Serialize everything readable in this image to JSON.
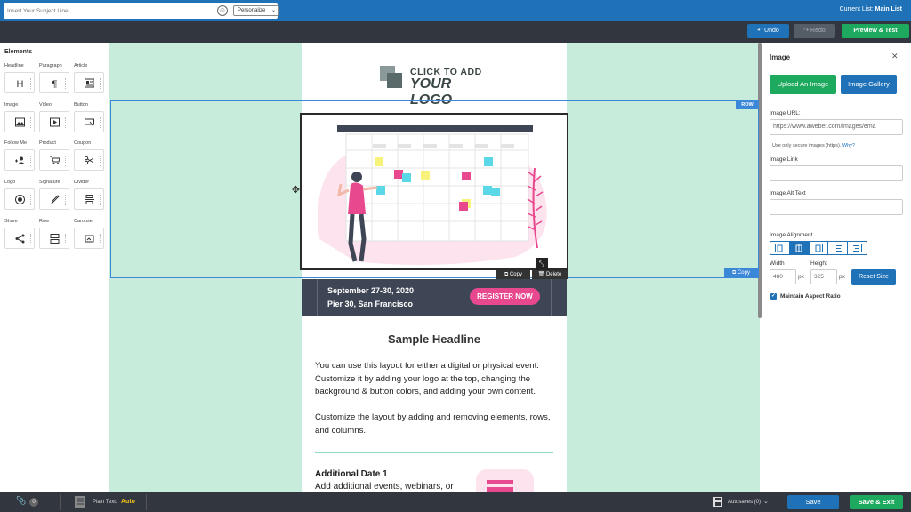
{
  "header": {
    "current_list_label": "Current List:",
    "current_list_value": "Main List"
  },
  "toolbar": {
    "subject_placeholder": "Insert Your Subject Line...",
    "personalize_label": "Personalize",
    "undo_label": "Undo",
    "redo_label": "Redo",
    "preview_label": "Preview & Test"
  },
  "elements_panel": {
    "title": "Elements",
    "items": [
      {
        "label": "Headline",
        "icon": "headline-icon"
      },
      {
        "label": "Paragraph",
        "icon": "paragraph-icon"
      },
      {
        "label": "Article",
        "icon": "article-icon"
      },
      {
        "label": "Image",
        "icon": "image-icon"
      },
      {
        "label": "Video",
        "icon": "video-icon"
      },
      {
        "label": "Button",
        "icon": "button-icon"
      },
      {
        "label": "Follow Me",
        "icon": "follow-me-icon"
      },
      {
        "label": "Product",
        "icon": "cart-icon"
      },
      {
        "label": "Coupon",
        "icon": "scissors-icon"
      },
      {
        "label": "Logo",
        "icon": "logo-icon"
      },
      {
        "label": "Signature",
        "icon": "pen-icon"
      },
      {
        "label": "Divider",
        "icon": "divider-icon"
      },
      {
        "label": "Share",
        "icon": "share-icon"
      },
      {
        "label": "Row",
        "icon": "row-icon"
      },
      {
        "label": "Carousel",
        "icon": "carousel-icon"
      }
    ]
  },
  "canvas": {
    "logo_line1": "CLICK TO ADD",
    "logo_line2": "YOUR LOGO",
    "row_tag": "ROW",
    "row_copy": "Copy",
    "image_copy": "Copy",
    "image_delete": "Delete",
    "banner_line1": "September 27-30, 2020",
    "banner_line2": "Pier 30, San Francisco",
    "register_label": "REGISTER NOW",
    "headline": "Sample Headline",
    "paragraph1": "You can use this layout for either a digital or physical event. Customize it by adding your logo at the top, changing the background & button colors, and adding your own content.",
    "paragraph2": "Customize the layout by adding and removing elements, rows, and columns.",
    "additional_date": "Additional Date 1",
    "additional_events": "Add additional events, webinars, or"
  },
  "image_panel": {
    "title": "Image",
    "upload_label": "Upload An Image",
    "gallery_label": "Image Gallery",
    "url_label": "Image URL:",
    "url_value": "https://www.aweber.com/images/ema",
    "secure_note": "Use only secure images (https).",
    "secure_link": "Why?",
    "link_label": "Image Link",
    "alt_label": "Image Alt Text",
    "alignment_label": "Image Alignment",
    "width_label": "Width",
    "height_label": "Height",
    "width_value": "480",
    "height_value": "325",
    "px_unit": "px",
    "reset_label": "Reset Size",
    "aspect_label": "Maintain Aspect Ratio"
  },
  "bottom": {
    "attachments_count": "0",
    "plain_text_label": "Plain Text:",
    "plain_text_value": "Auto",
    "autosaves_label": "Autosaves (0)",
    "save_label": "Save",
    "save_exit_label": "Save & Exit"
  },
  "colors": {
    "brand_blue": "#1f72b8",
    "green": "#1eaa5e",
    "canvas_bg": "#c8ecdb",
    "banner": "#3e4554",
    "pink": "#e8488e"
  }
}
